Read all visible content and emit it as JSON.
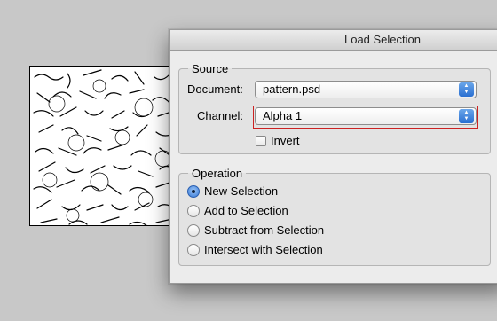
{
  "dialog": {
    "title": "Load Selection",
    "source": {
      "legend": "Source",
      "document_label": "Document:",
      "document_value": "pattern.psd",
      "channel_label": "Channel:",
      "channel_value": "Alpha 1",
      "invert_label": "Invert",
      "invert_checked": false
    },
    "operation": {
      "legend": "Operation",
      "options": [
        {
          "label": "New Selection",
          "selected": true
        },
        {
          "label": "Add to Selection",
          "selected": false
        },
        {
          "label": "Subtract from Selection",
          "selected": false
        },
        {
          "label": "Intersect with Selection",
          "selected": false
        }
      ]
    }
  },
  "colors": {
    "highlight_outline": "#cc2222",
    "radio_accent": "#3477d6",
    "popup_arrow": "#2a6fd1"
  }
}
